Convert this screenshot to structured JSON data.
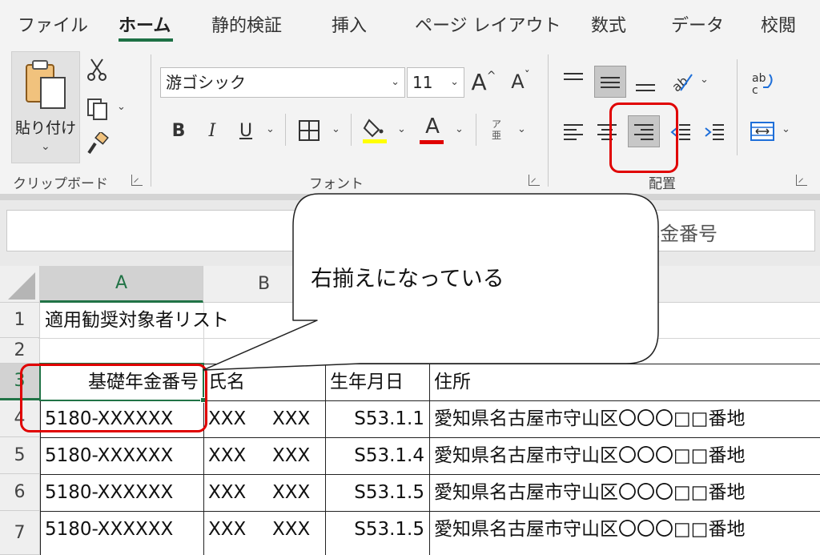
{
  "ribbon": {
    "tabs": [
      "ファイル",
      "ホーム",
      "静的検証",
      "挿入",
      "ページ レイアウト",
      "数式",
      "データ",
      "校閲"
    ],
    "active_tab": "ホーム",
    "clipboard": {
      "paste_label": "貼り付け",
      "group_label": "クリップボード"
    },
    "font": {
      "font_name": "游ゴシック",
      "font_size": "11",
      "bold": "B",
      "italic": "I",
      "underline": "U",
      "ruby": "ア亜",
      "font_color_letter": "A",
      "grow_letter": "A",
      "shrink_letter": "A",
      "group_label": "フォント",
      "highlight_color": "#ffff00",
      "font_color": "#e00000"
    },
    "alignment": {
      "group_label": "配置",
      "wrap_text_icon": "ab↵c"
    }
  },
  "formula_bar": {
    "content": "年金番号"
  },
  "grid": {
    "columns": [
      "A",
      "B"
    ],
    "rows": [
      "1",
      "2",
      "3",
      "4",
      "5",
      "6",
      "7"
    ],
    "title": "適用勧奨対象者リスト",
    "headers": {
      "a": "基礎年金番号",
      "b": "氏名",
      "c": "生年月日",
      "d": "住所"
    },
    "records": [
      {
        "number": "5180-XXXXXX",
        "name1": "XXX",
        "name2": "XXX",
        "dob": "S53.1.1",
        "address": "愛知県名古屋市守山区〇〇〇□□番地"
      },
      {
        "number": "5180-XXXXXX",
        "name1": "XXX",
        "name2": "XXX",
        "dob": "S53.1.4",
        "address": "愛知県名古屋市守山区〇〇〇□□番地"
      },
      {
        "number": "5180-XXXXXX",
        "name1": "XXX",
        "name2": "XXX",
        "dob": "S53.1.5",
        "address": "愛知県名古屋市守山区〇〇〇□□番地"
      },
      {
        "number": "5180-XXXXXX",
        "name1": "XXX",
        "name2": "XXX",
        "dob": "S53.1.5",
        "address": "愛知県名古屋市守山区〇〇〇□□番地"
      }
    ]
  },
  "annotation": {
    "callout_text": "右揃えになっている",
    "highlight_color": "#e00000"
  }
}
